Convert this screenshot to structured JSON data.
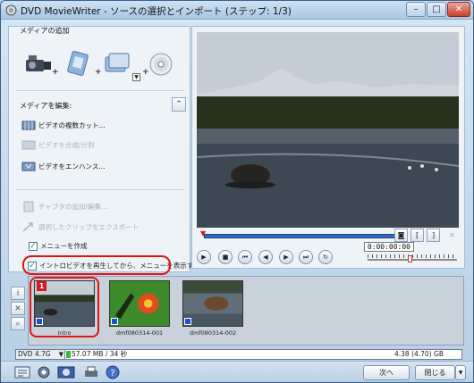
{
  "window": {
    "title": "DVD MovieWriter - ソースの選択とインポート (ステップ: 1/3)",
    "minimize": "–",
    "restore": "□",
    "close": "✕"
  },
  "left": {
    "add_media_label": "メディアの追加",
    "edit_media_label": "メディアを編集:",
    "edit_items": [
      {
        "label": "ビデオの複数カット...",
        "enabled": true
      },
      {
        "label": "ビデオを合成/分割",
        "enabled": false
      },
      {
        "label": "ビデオをエンハンス...",
        "enabled": true
      }
    ],
    "extra_items": [
      {
        "label": "チャプタの追加/編集...",
        "enabled": false
      },
      {
        "label": "選択したクリップをエクスポート",
        "enabled": false
      }
    ],
    "checkbox_menu": "メニューを作成",
    "checkbox_intro": "イントロビデオを再生してから、メニューを表示する"
  },
  "preview": {
    "timecode": "0:00:00:00"
  },
  "tray": {
    "clips": [
      {
        "caption": "intro",
        "number": "1"
      },
      {
        "caption": "dmf080314-001"
      },
      {
        "caption": "dmf080314-002"
      }
    ]
  },
  "status": {
    "disc_type": "DVD 4.7G",
    "used": "57.07 MB / 34 秒",
    "total": "4.38 (4.70) GB",
    "used_fraction": 0.013
  },
  "buttons": {
    "next": "次へ",
    "close": "閉じる"
  },
  "colors": {
    "highlight": "#e01414",
    "timeline": "#2f68c8",
    "clip_badge": "#1f4fd1"
  }
}
